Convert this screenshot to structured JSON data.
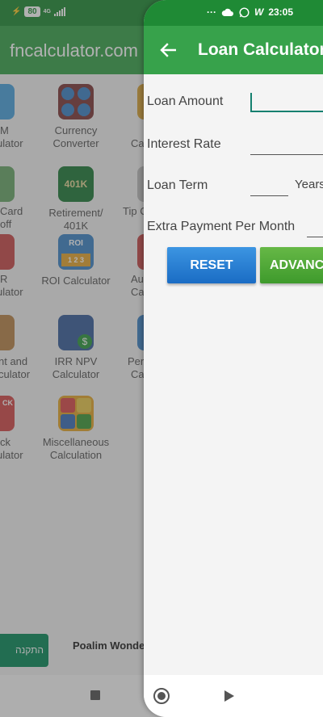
{
  "colors": {
    "toolbar": "#37a24b",
    "status_bar": "#1f8a35",
    "reset_button": "#1a6cc4",
    "advanced_button": "#3e9a2c",
    "input_focus": "#14806f"
  },
  "status_bar_left": {
    "battery": "80",
    "network": "4G"
  },
  "status_bar_right": {
    "dots": "···",
    "icons": [
      "cloud-icon",
      "whatsapp-icon",
      "w-icon"
    ],
    "time": "23:05"
  },
  "background_app": {
    "title": "fncalculator.com",
    "tiles": [
      {
        "label_line1": "M",
        "label_line2": "ulator"
      },
      {
        "label_line1": "Currency",
        "label_line2": "Converter"
      },
      {
        "label_line1": "Ca",
        "label_line2": ""
      },
      {
        "label_line1": "Card",
        "label_line2": "off"
      },
      {
        "label_line1": "Retirement/",
        "label_line2": "401K",
        "icon_text": "401K"
      },
      {
        "label_line1": "Tip C",
        "label_line2": ""
      },
      {
        "label_line1": "R",
        "label_line2": "ulator"
      },
      {
        "label_line1": "ROI Calculator",
        "label_line2": "",
        "icon_text": "ROI",
        "icon_subtext": "1 2 3"
      },
      {
        "label_line1": "Au",
        "label_line2": "Ca"
      },
      {
        "label_line1": "nt and",
        "label_line2": "culator"
      },
      {
        "label_line1": "IRR NPV",
        "label_line2": "Calculator"
      },
      {
        "label_line1": "Per",
        "label_line2": "Ca"
      },
      {
        "label_line1": "ck",
        "label_line2": "ulator",
        "icon_text": "CK"
      },
      {
        "label_line1": "Miscellaneous",
        "label_line2": "Calculation"
      }
    ],
    "ad": {
      "button_label": "התקנה",
      "text": "Poalim Wonder"
    }
  },
  "drawer": {
    "title": "Loan Calculator",
    "fields": {
      "loan_amount": {
        "label": "Loan Amount",
        "value": ""
      },
      "interest_rate": {
        "label": "Interest Rate",
        "value": ""
      },
      "loan_term": {
        "label": "Loan Term",
        "value": "",
        "unit": "Years"
      },
      "extra_payment": {
        "label": "Extra Payment Per Month",
        "value": ""
      }
    },
    "buttons": {
      "reset": "RESET",
      "advanced": "ADVANC"
    }
  }
}
